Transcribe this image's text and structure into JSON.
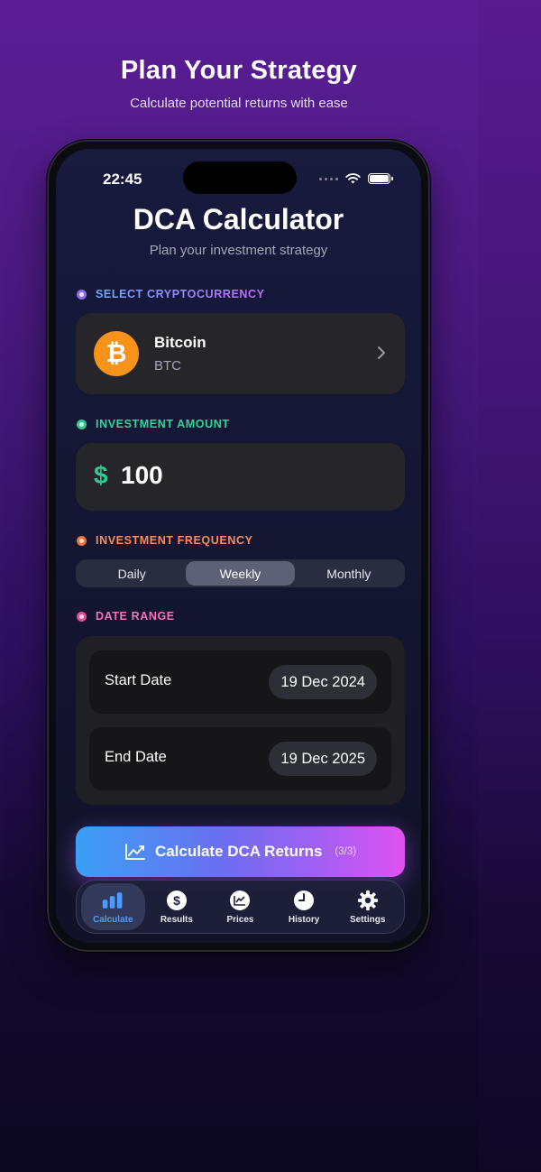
{
  "promo": {
    "headline": "Plan Your Strategy",
    "subline": "Calculate potential returns with ease"
  },
  "status_bar": {
    "time": "22:45"
  },
  "app": {
    "title": "DCA Calculator",
    "subtitle": "Plan your investment strategy"
  },
  "crypto_section": {
    "label": "SELECT CRYPTOCURRENCY",
    "label_color": "#a78bfa",
    "name": "Bitcoin",
    "symbol": "BTC",
    "logo_glyph": "₿",
    "icon": "bitcoin-logo",
    "accent": "#f7931a"
  },
  "amount_section": {
    "label": "INVESTMENT AMOUNT",
    "label_color": "#34d399",
    "currency": "$",
    "value": "100"
  },
  "frequency_section": {
    "label": "INVESTMENT FREQUENCY",
    "label_color": "#fb8c5a",
    "options": [
      "Daily",
      "Weekly",
      "Monthly"
    ],
    "selected": "Weekly"
  },
  "date_section": {
    "label": "DATE RANGE",
    "label_color": "#f472b6",
    "start_label": "Start Date",
    "start_value": "19 Dec 2024",
    "end_label": "End Date",
    "end_value": "19 Dec 2025"
  },
  "calculate_button": {
    "label": "Calculate DCA Returns",
    "count": "(3/3)",
    "icon": "chart-line-icon"
  },
  "tab_bar": {
    "items": [
      {
        "label": "Calculate",
        "icon": "bar-chart-icon",
        "active": true
      },
      {
        "label": "Results",
        "icon": "dollar-circle-icon",
        "active": false
      },
      {
        "label": "Prices",
        "icon": "price-chart-icon",
        "active": false
      },
      {
        "label": "History",
        "icon": "clock-icon",
        "active": false
      },
      {
        "label": "Settings",
        "icon": "gear-icon",
        "active": false
      }
    ],
    "active_color": "#4d9bff"
  }
}
